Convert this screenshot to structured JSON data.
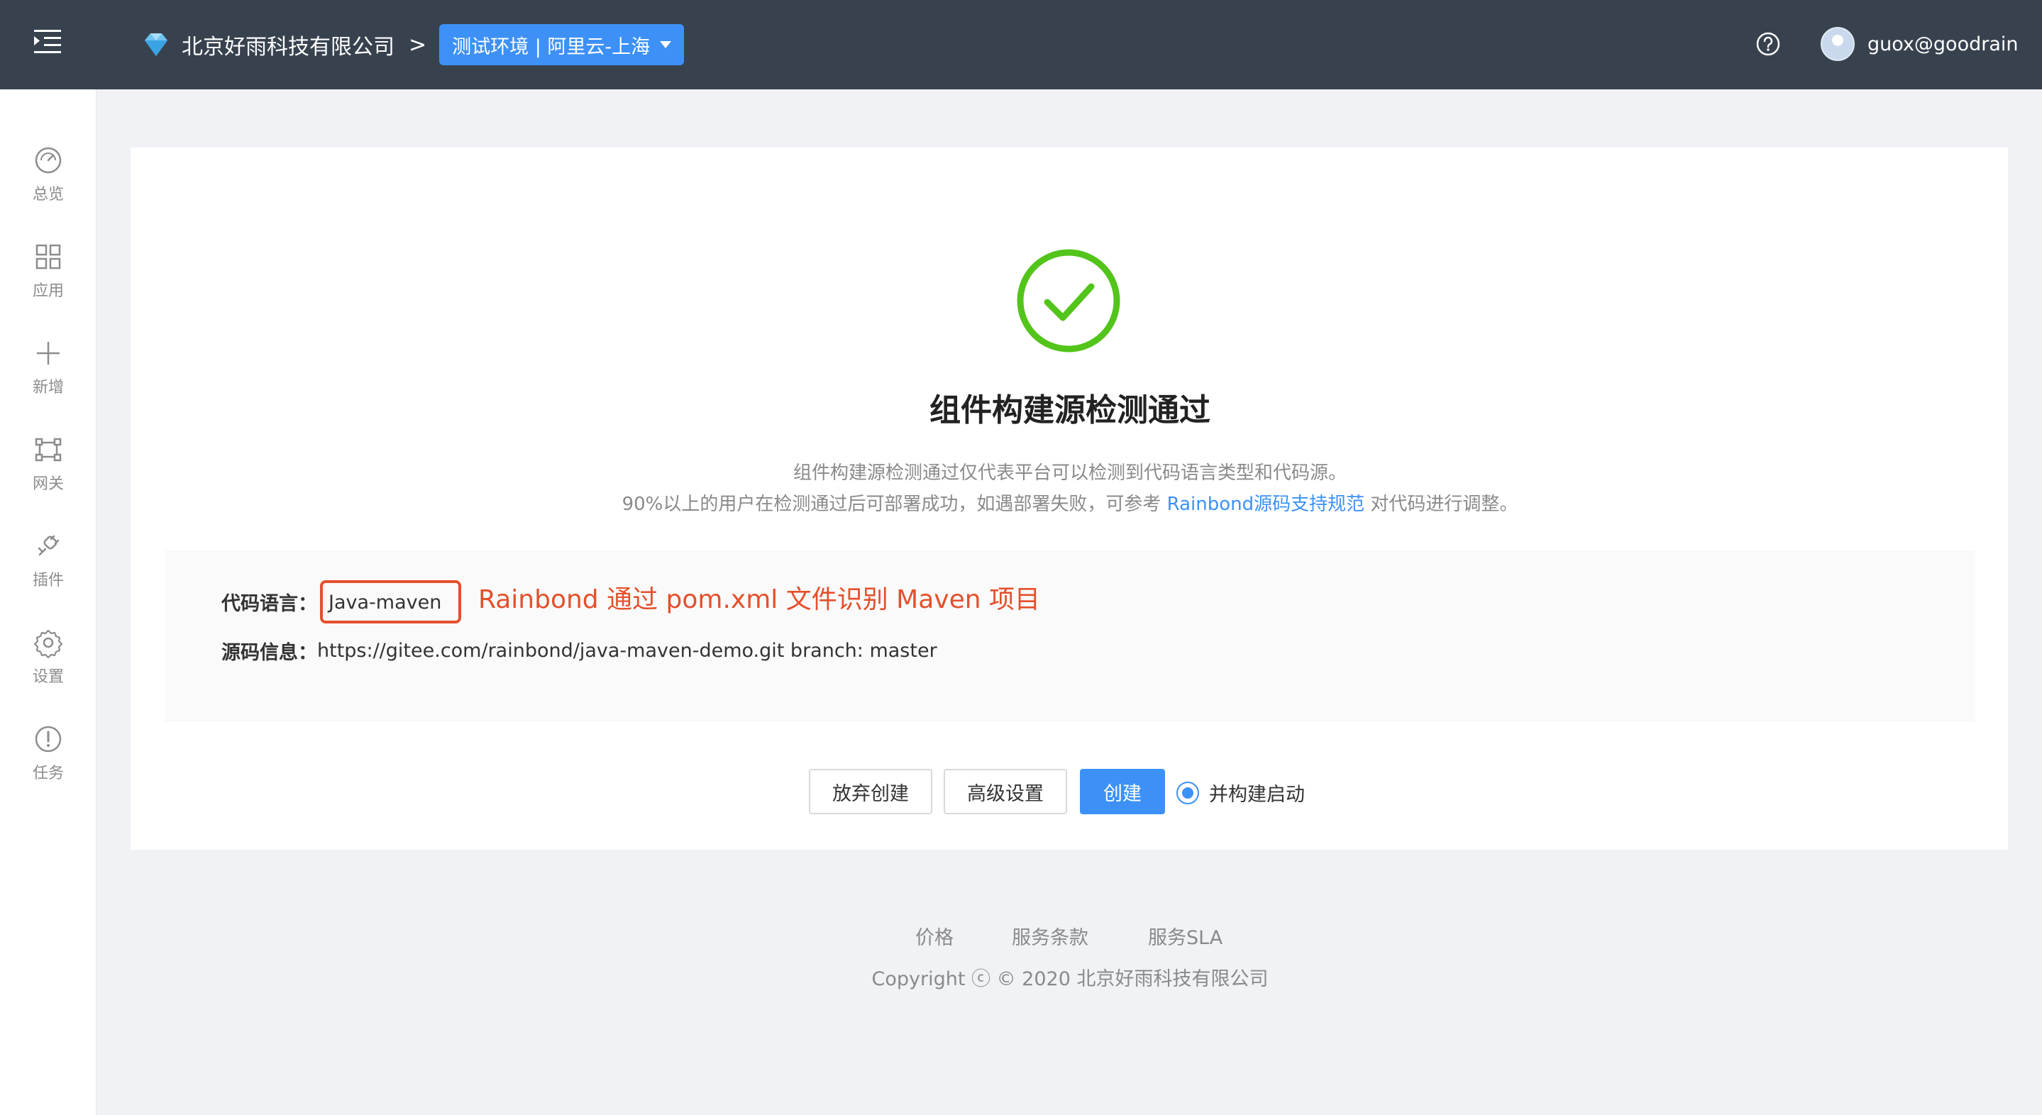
{
  "header": {
    "company": "北京好雨科技有限公司",
    "separator": ">",
    "environment": "测试环境 | 阿里云-上海",
    "user": "guox@goodrain"
  },
  "sidebar": {
    "items": [
      {
        "label": "总览",
        "icon": "dashboard-icon"
      },
      {
        "label": "应用",
        "icon": "apps-icon"
      },
      {
        "label": "新增",
        "icon": "plus-icon"
      },
      {
        "label": "网关",
        "icon": "gateway-icon"
      },
      {
        "label": "插件",
        "icon": "plugin-icon"
      },
      {
        "label": "设置",
        "icon": "gear-icon"
      },
      {
        "label": "任务",
        "icon": "task-icon"
      }
    ]
  },
  "result": {
    "title": "组件构建源检测通过",
    "desc_line1": "组件构建源检测通过仅代表平台可以检测到代码语言类型和代码源。",
    "desc_line2_prefix": "90%以上的用户在检测通过后可部署成功，如遇部署失败，可参考 ",
    "desc_line2_link": "Rainbond源码支持规范",
    "desc_line2_suffix": " 对代码进行调整。"
  },
  "info": {
    "lang_label": "代码语言：",
    "lang_value": "Java-maven",
    "annotation": "Rainbond 通过 pom.xml 文件识别 Maven 项目",
    "src_label": "源码信息：",
    "src_value": "https://gitee.com/rainbond/java-maven-demo.git branch: master"
  },
  "actions": {
    "abandon": "放弃创建",
    "advanced": "高级设置",
    "create": "创建",
    "build_start": "并构建启动"
  },
  "footer": {
    "price": "价格",
    "terms": "服务条款",
    "sla": "服务SLA",
    "copyright": "Copyright ⓒ © 2020 北京好雨科技有限公司"
  },
  "colors": {
    "header_bg": "#38424f",
    "primary": "#3d91f6",
    "success": "#52c41a",
    "annotation": "#e3502c"
  }
}
